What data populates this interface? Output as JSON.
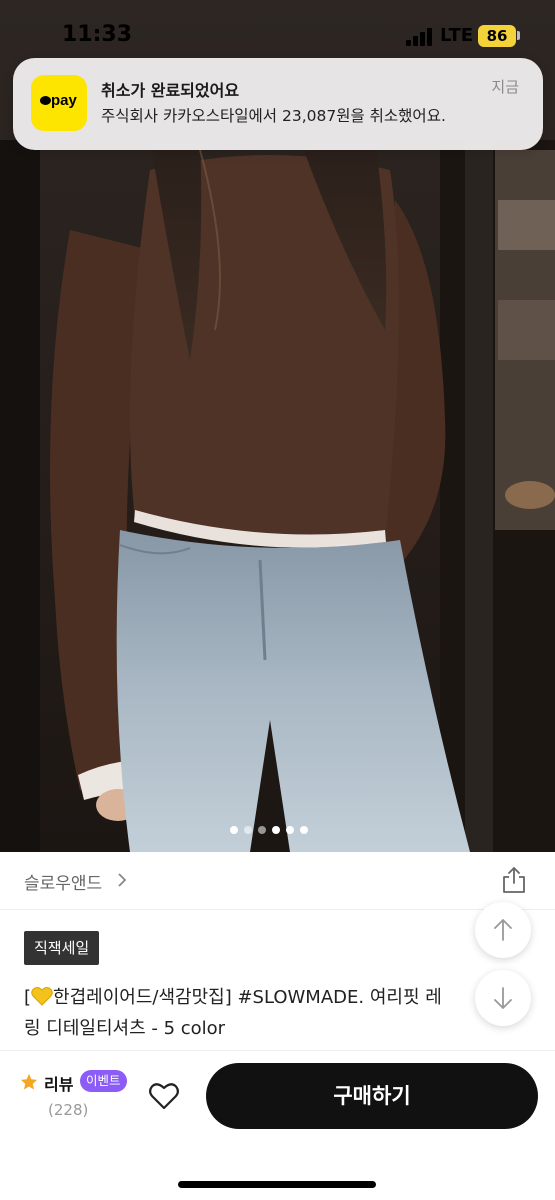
{
  "status_bar": {
    "time": "11:33",
    "network": "LTE",
    "battery": "86"
  },
  "notification": {
    "app_icon_label": "pay",
    "title": "취소가 완료되었어요",
    "body": "주식회사 카카오스타일에서 23,087원을 취소했어요.",
    "time": "지금"
  },
  "carousel": {
    "total_dots": 6,
    "active_index": 0
  },
  "product": {
    "brand": "슬로우앤드",
    "badge": "직잭세일",
    "title_line1_prefix": "[",
    "title_line1": "한겹레이어드/색감맛집] #SLOWMADE. 여리핏 레",
    "title_line2": "링 디테일티셔츠 - 5 color"
  },
  "bottom_bar": {
    "review_label": "리뷰",
    "event_badge": "이벤트",
    "review_count": "(228)",
    "buy_button": "구매하기"
  },
  "colors": {
    "accent_yellow": "#fee500",
    "event_purple": "#8b5cf6",
    "buy_button_bg": "#111111",
    "star": "#f5a623"
  },
  "icons": [
    "kakao-pay-icon",
    "chevron-right-icon",
    "share-icon",
    "arrow-up-icon",
    "arrow-down-icon",
    "star-icon",
    "heart-icon",
    "yellow-heart-icon"
  ]
}
